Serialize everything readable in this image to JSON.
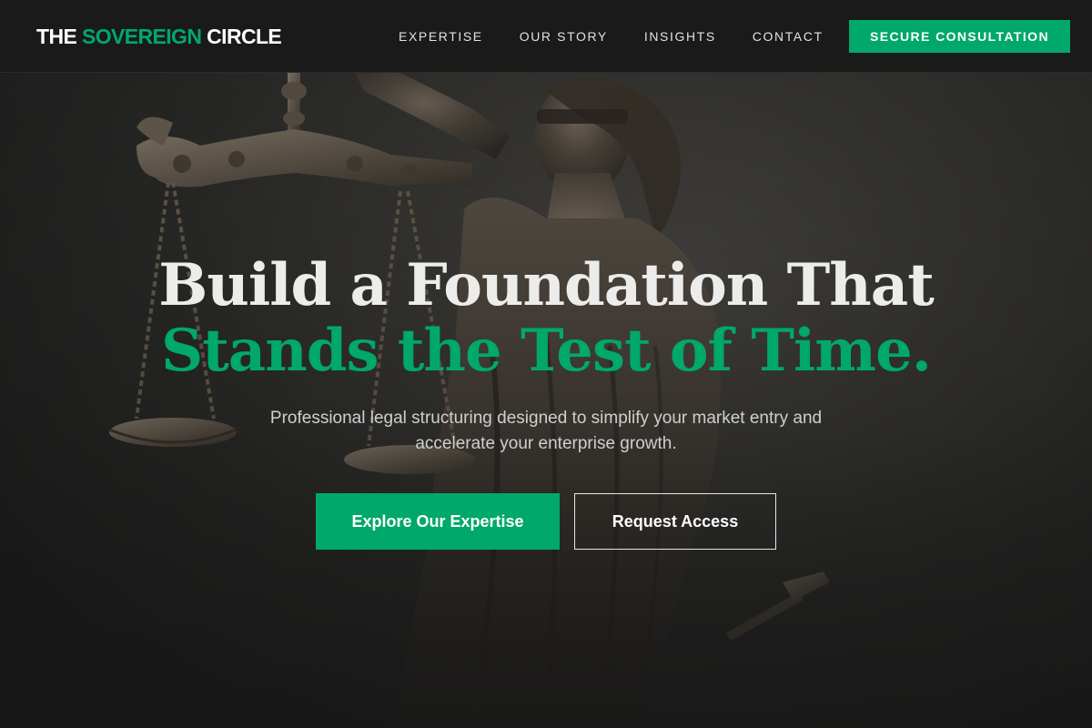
{
  "brand": {
    "prefix": "THE",
    "accent": "SOVEREIGN",
    "suffix": "CIRCLE"
  },
  "nav": {
    "items": [
      {
        "label": "EXPERTISE"
      },
      {
        "label": "OUR STORY"
      },
      {
        "label": "INSIGHTS"
      },
      {
        "label": "CONTACT"
      }
    ],
    "cta_label": "SECURE CONSULTATION"
  },
  "hero": {
    "headline_line1": "Build a Foundation That",
    "headline_line2": "Stands the Test of Time.",
    "subtext": "Professional legal structuring designed to simplify your market entry and accelerate your enterprise growth.",
    "primary_button": "Explore Our Expertise",
    "secondary_button": "Request Access",
    "background_image": "lady-justice-statue"
  },
  "colors": {
    "accent": "#00a86b",
    "header_bg": "#1a1a1a",
    "hero_bg": "#2b2b29"
  }
}
